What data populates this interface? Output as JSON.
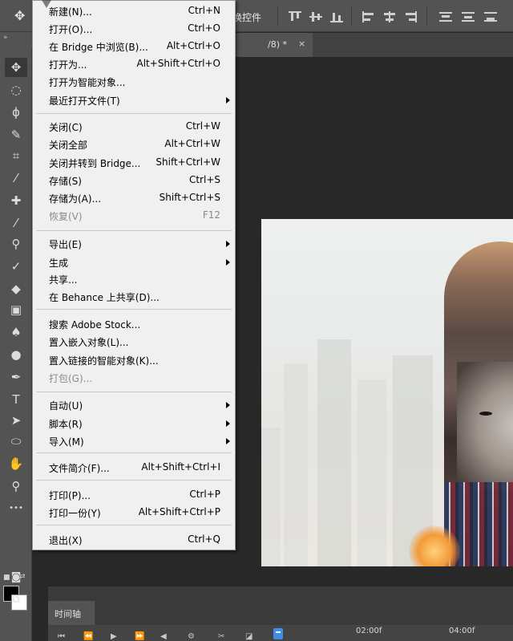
{
  "options_bar": {
    "partial_label": "换控件"
  },
  "document_tab": {
    "title_fragment": "/8) *",
    "close_symbol": "×"
  },
  "tools": [
    {
      "name": "move-tool-icon",
      "glyph": "✥",
      "active": true
    },
    {
      "name": "marquee-tool-icon",
      "glyph": "◌"
    },
    {
      "name": "lasso-tool-icon",
      "glyph": "ϕ"
    },
    {
      "name": "quick-select-tool-icon",
      "glyph": "✎"
    },
    {
      "name": "crop-tool-icon",
      "glyph": "⌗"
    },
    {
      "name": "eyedropper-tool-icon",
      "glyph": "⁄"
    },
    {
      "name": "healing-brush-tool-icon",
      "glyph": "✚"
    },
    {
      "name": "brush-tool-icon",
      "glyph": "⁄"
    },
    {
      "name": "clone-stamp-tool-icon",
      "glyph": "⚲"
    },
    {
      "name": "history-brush-tool-icon",
      "glyph": "✓"
    },
    {
      "name": "eraser-tool-icon",
      "glyph": "◆"
    },
    {
      "name": "gradient-tool-icon",
      "glyph": "▣"
    },
    {
      "name": "blur-tool-icon",
      "glyph": "♠"
    },
    {
      "name": "dodge-tool-icon",
      "glyph": "●"
    },
    {
      "name": "pen-tool-icon",
      "glyph": "✒"
    },
    {
      "name": "type-tool-icon",
      "glyph": "T"
    },
    {
      "name": "path-select-tool-icon",
      "glyph": "➤"
    },
    {
      "name": "ellipse-tool-icon",
      "glyph": "⬭"
    },
    {
      "name": "hand-tool-icon",
      "glyph": "✋"
    },
    {
      "name": "zoom-tool-icon",
      "glyph": "⚲"
    },
    {
      "name": "more-tools-icon",
      "glyph": "•••"
    }
  ],
  "file_menu": {
    "items": [
      {
        "label": "新建(N)...",
        "shortcut": "Ctrl+N"
      },
      {
        "label": "打开(O)...",
        "shortcut": "Ctrl+O"
      },
      {
        "label": "在 Bridge 中浏览(B)...",
        "shortcut": "Alt+Ctrl+O"
      },
      {
        "label": "打开为...",
        "shortcut": "Alt+Shift+Ctrl+O"
      },
      {
        "label": "打开为智能对象...",
        "shortcut": ""
      },
      {
        "label": "最近打开文件(T)",
        "shortcut": "",
        "submenu": true
      },
      {
        "label": "关闭(C)",
        "shortcut": "Ctrl+W"
      },
      {
        "label": "关闭全部",
        "shortcut": "Alt+Ctrl+W"
      },
      {
        "label": "关闭并转到 Bridge...",
        "shortcut": "Shift+Ctrl+W"
      },
      {
        "label": "存储(S)",
        "shortcut": "Ctrl+S"
      },
      {
        "label": "存储为(A)...",
        "shortcut": "Shift+Ctrl+S"
      },
      {
        "label": "恢复(V)",
        "shortcut": "F12",
        "disabled": true
      },
      {
        "label": "导出(E)",
        "shortcut": "",
        "submenu": true
      },
      {
        "label": "生成",
        "shortcut": "",
        "submenu": true
      },
      {
        "label": "共享...",
        "shortcut": ""
      },
      {
        "label": "在 Behance 上共享(D)...",
        "shortcut": ""
      },
      {
        "label": "搜索 Adobe Stock...",
        "shortcut": ""
      },
      {
        "label": "置入嵌入对象(L)...",
        "shortcut": ""
      },
      {
        "label": "置入链接的智能对象(K)...",
        "shortcut": ""
      },
      {
        "label": "打包(G)...",
        "shortcut": "",
        "disabled": true
      },
      {
        "label": "自动(U)",
        "shortcut": "",
        "submenu": true
      },
      {
        "label": "脚本(R)",
        "shortcut": "",
        "submenu": true
      },
      {
        "label": "导入(M)",
        "shortcut": "",
        "submenu": true
      },
      {
        "label": "文件简介(F)...",
        "shortcut": "Alt+Shift+Ctrl+I"
      },
      {
        "label": "打印(P)...",
        "shortcut": "Ctrl+P"
      },
      {
        "label": "打印一份(Y)",
        "shortcut": "Alt+Shift+Ctrl+P"
      },
      {
        "label": "退出(X)",
        "shortcut": "Ctrl+Q"
      }
    ]
  },
  "timeline": {
    "tab_label": "时间轴",
    "time_marks": [
      "02:00f",
      "04:00f"
    ]
  },
  "colors": {
    "foreground": "#000000",
    "background": "#ffffff",
    "playhead": "#3d8ee8"
  }
}
